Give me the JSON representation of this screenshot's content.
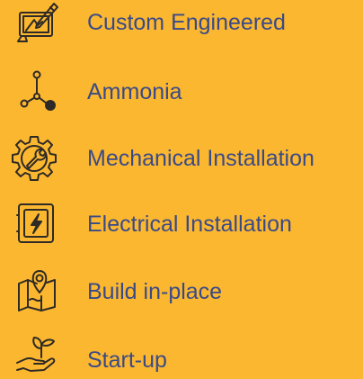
{
  "colors": {
    "background": "#FBB72F",
    "text": "#3A4A88",
    "icon_stroke": "#2E2A26"
  },
  "services": {
    "items": [
      {
        "label": "Custom Engineered",
        "icon": "blueprint-tools-icon"
      },
      {
        "label": "Ammonia",
        "icon": "molecule-icon"
      },
      {
        "label": "Mechanical Installation",
        "icon": "gear-wrench-icon"
      },
      {
        "label": "Electrical Installation",
        "icon": "electrical-panel-icon"
      },
      {
        "label": "Build in-place",
        "icon": "map-location-icon"
      },
      {
        "label": "Start-up",
        "icon": "hand-plant-icon"
      }
    ]
  }
}
